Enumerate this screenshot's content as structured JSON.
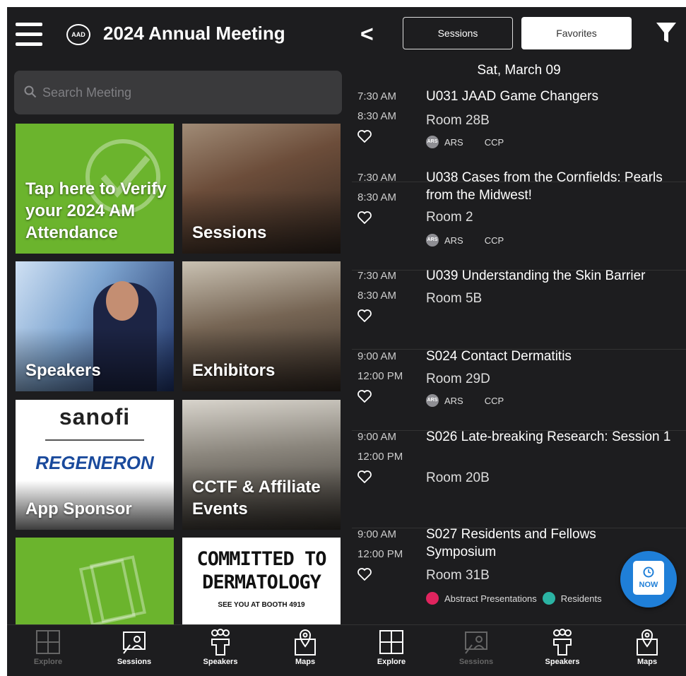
{
  "left": {
    "header": {
      "title": "2024 Annual Meeting",
      "logo_text": "AAD"
    },
    "search": {
      "placeholder": "Search Meeting"
    },
    "tiles": {
      "verify": "Tap here to Verify your 2024 AM Attendance",
      "sessions": "Sessions",
      "speakers": "Speakers",
      "exhibitors": "Exhibitors",
      "sponsor": {
        "label": "App Sponsor",
        "logo1": "sanofi",
        "logo2": "REGENERON"
      },
      "cctf": "CCTF & Affiliate Events",
      "committed": {
        "line1": "COMMITTED TO",
        "line2": "DERMATOLOGY",
        "line3": "SEE YOU AT BOOTH 4919"
      }
    },
    "nav": [
      {
        "label": "Explore",
        "icon": "grid-icon",
        "active": false
      },
      {
        "label": "Sessions",
        "icon": "presentation-icon",
        "active": true
      },
      {
        "label": "Speakers",
        "icon": "people-icon",
        "active": true
      },
      {
        "label": "Maps",
        "icon": "map-pin-icon",
        "active": true
      }
    ]
  },
  "right": {
    "back": "<",
    "segments": {
      "sessions": "Sessions",
      "favorites": "Favorites"
    },
    "date": "Sat, March 09",
    "sessions": [
      {
        "start": "7:30 AM",
        "end": "8:30 AM",
        "title": "U031 JAAD Game Changers",
        "room": "Room 28B",
        "tags": [
          "ARS",
          "CCP"
        ]
      },
      {
        "start": "7:30 AM",
        "end": "8:30 AM",
        "title": "U038 Cases from the Cornfields: Pearls from the Midwest!",
        "room": "Room 2",
        "tags": [
          "ARS",
          "CCP"
        ]
      },
      {
        "start": "7:30 AM",
        "end": "8:30 AM",
        "title": "U039 Understanding the Skin Barrier",
        "room": "Room 5B",
        "tags": []
      },
      {
        "start": "9:00 AM",
        "end": "12:00 PM",
        "title": "S024 Contact Dermatitis",
        "room": "Room 29D",
        "tags": [
          "ARS",
          "CCP"
        ]
      },
      {
        "start": "9:00 AM",
        "end": "12:00 PM",
        "title": "S026 Late-breaking Research: Session 1",
        "room": "Room 20B",
        "tags": []
      },
      {
        "start": "9:00 AM",
        "end": "12:00 PM",
        "title": "S027 Residents and Fellows Symposium",
        "room": "Room 31B",
        "tags": [
          "Abstract Presentations",
          "Residents"
        ]
      }
    ],
    "ars_badge": "ARS",
    "now_button": "NOW",
    "nav": [
      {
        "label": "Explore",
        "icon": "grid-icon",
        "active": true
      },
      {
        "label": "Sessions",
        "icon": "presentation-icon",
        "active": false
      },
      {
        "label": "Speakers",
        "icon": "people-icon",
        "active": true
      },
      {
        "label": "Maps",
        "icon": "map-pin-icon",
        "active": true
      }
    ]
  },
  "colors": {
    "background": "#1d1d1f",
    "accent_green": "#6bb42d",
    "fab_blue": "#1f7fd8",
    "abstract_tag": "#e0245e",
    "residents_tag": "#2bb3a3"
  }
}
